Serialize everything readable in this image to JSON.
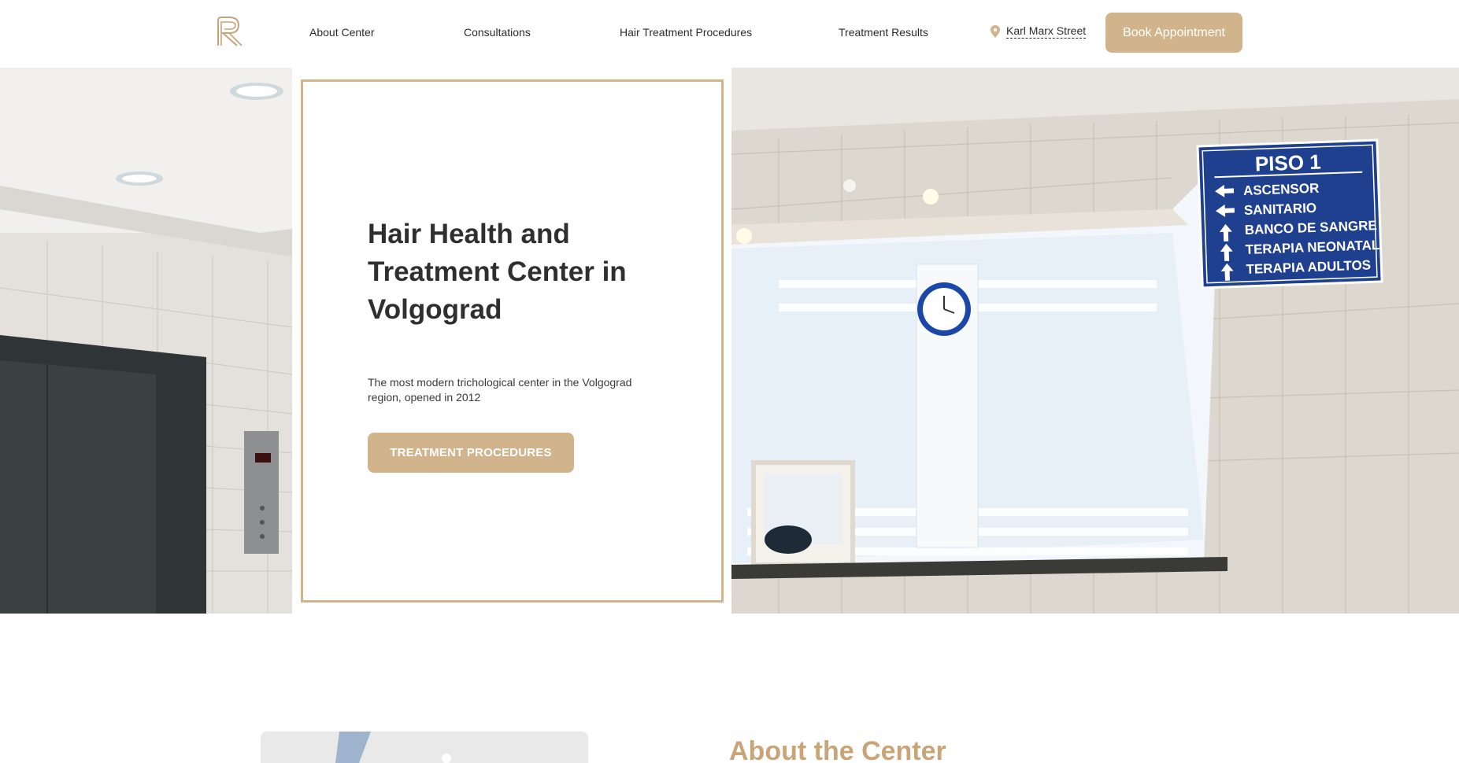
{
  "header": {
    "nav": [
      {
        "label": "About Center"
      },
      {
        "label": "Consultations"
      },
      {
        "label": "Hair Treatment Procedures"
      },
      {
        "label": "Treatment Results"
      }
    ],
    "address": "Karl Marx Street",
    "book_label": "Book Appointment"
  },
  "hero": {
    "title": "Hair Health and Treatment Center in Volgograd",
    "subtitle": "The most modern trichological center in the Volgograd region, opened in 2012",
    "button_label": "TREATMENT PROCEDURES",
    "sign": {
      "title": "PISO 1",
      "items": [
        "ASCENSOR",
        "SANITARIO",
        "BANCO DE SANGRE",
        "TERAPIA NEONATAL",
        "TERAPIA ADULTOS"
      ]
    }
  },
  "about": {
    "title": "About the Center"
  },
  "colors": {
    "accent": "#d2b48c",
    "text": "#2b2b2b",
    "heading_gold": "#c9a477",
    "sign_blue": "#1f3f8f"
  },
  "icons": {
    "logo": "logo-r-mark",
    "address": "map-pin-icon"
  }
}
